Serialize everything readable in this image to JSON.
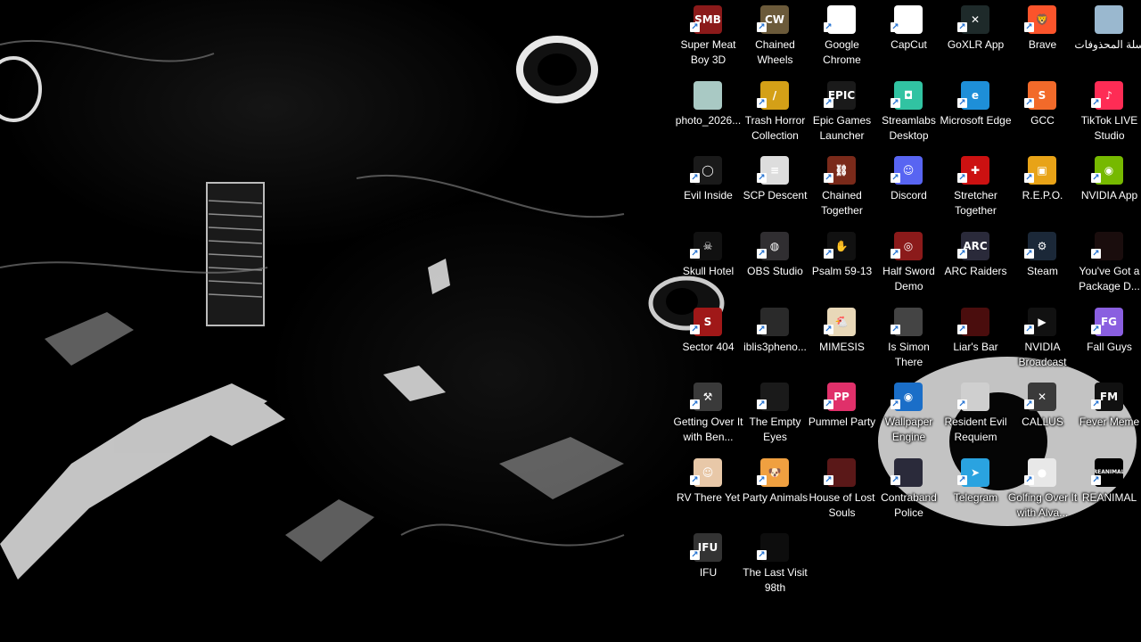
{
  "desktop": {
    "icons": [
      {
        "label": "Super Meat Boy 3D",
        "icon": "super-meat-boy-3d-icon",
        "color": "#8b1a1a",
        "glyph": "SMB",
        "shortcut": true
      },
      {
        "label": "Chained Wheels",
        "icon": "chained-wheels-icon",
        "color": "#6b5a3a",
        "glyph": "CW",
        "shortcut": true
      },
      {
        "label": "Google Chrome",
        "icon": "chrome-icon",
        "color": "#ffffff",
        "glyph": "",
        "shortcut": true
      },
      {
        "label": "CapCut",
        "icon": "capcut-icon",
        "color": "#ffffff",
        "glyph": "✂",
        "shortcut": true
      },
      {
        "label": "GoXLR App",
        "icon": "goxlr-icon",
        "color": "#1e2a2a",
        "glyph": "✕",
        "shortcut": true
      },
      {
        "label": "Brave",
        "icon": "brave-icon",
        "color": "#fb542b",
        "glyph": "🦁",
        "shortcut": true
      },
      {
        "label": "سلة المحذوفات",
        "icon": "recycle-bin-icon",
        "color": "#9ab8cf",
        "glyph": "",
        "shortcut": false
      },
      {
        "label": "photo_2026...",
        "icon": "photo-file-icon",
        "color": "#a9c9c4",
        "glyph": "",
        "shortcut": false
      },
      {
        "label": "Trash Horror Collection",
        "icon": "trash-horror-collection-icon",
        "color": "#d4a017",
        "glyph": "/",
        "shortcut": true
      },
      {
        "label": "Epic Games Launcher",
        "icon": "epic-games-icon",
        "color": "#1a1a1a",
        "glyph": "EPIC",
        "shortcut": true
      },
      {
        "label": "Streamlabs Desktop",
        "icon": "streamlabs-icon",
        "color": "#31c3a2",
        "glyph": "◘",
        "shortcut": true
      },
      {
        "label": "Microsoft Edge",
        "icon": "edge-icon",
        "color": "#1e8fd8",
        "glyph": "e",
        "shortcut": true
      },
      {
        "label": "GCC",
        "icon": "gcc-icon",
        "color": "#f26a2a",
        "glyph": "S",
        "shortcut": true
      },
      {
        "label": "TikTok LIVE Studio",
        "icon": "tiktok-live-studio-icon",
        "color": "#fe2c55",
        "glyph": "♪",
        "shortcut": true
      },
      {
        "label": "Evil Inside",
        "icon": "evil-inside-icon",
        "color": "#1a1a1a",
        "glyph": "◯",
        "shortcut": true
      },
      {
        "label": "SCP Descent",
        "icon": "scp-descent-icon",
        "color": "#dddddd",
        "glyph": "≡",
        "shortcut": true
      },
      {
        "label": "Chained Together",
        "icon": "chained-together-icon",
        "color": "#7a2a1a",
        "glyph": "⛓",
        "shortcut": true
      },
      {
        "label": "Discord",
        "icon": "discord-icon",
        "color": "#5865f2",
        "glyph": "☺",
        "shortcut": true
      },
      {
        "label": "Stretcher Together",
        "icon": "stretcher-together-icon",
        "color": "#cc1111",
        "glyph": "✚",
        "shortcut": true
      },
      {
        "label": "R.E.P.O.",
        "icon": "repo-icon",
        "color": "#e8a317",
        "glyph": "▣",
        "shortcut": true
      },
      {
        "label": "NVIDIA App",
        "icon": "nvidia-app-icon",
        "color": "#76b900",
        "glyph": "◉",
        "shortcut": true
      },
      {
        "label": "Skull Hotel",
        "icon": "skull-hotel-icon",
        "color": "#111111",
        "glyph": "☠",
        "shortcut": true
      },
      {
        "label": "OBS Studio",
        "icon": "obs-studio-icon",
        "color": "#302e31",
        "glyph": "◍",
        "shortcut": true
      },
      {
        "label": "Psalm 59-13",
        "icon": "psalm-59-13-icon",
        "color": "#111111",
        "glyph": "✋",
        "shortcut": true
      },
      {
        "label": "Half Sword Demo",
        "icon": "half-sword-demo-icon",
        "color": "#8b1a1a",
        "glyph": "◎",
        "shortcut": true
      },
      {
        "label": "ARC Raiders",
        "icon": "arc-raiders-icon",
        "color": "#2a2a3a",
        "glyph": "ARC",
        "shortcut": true
      },
      {
        "label": "Steam",
        "icon": "steam-icon",
        "color": "#1b2838",
        "glyph": "⚙",
        "shortcut": true
      },
      {
        "label": "You've Got a Package D...",
        "icon": "youve-got-a-package-icon",
        "color": "#1a0d0d",
        "glyph": "",
        "shortcut": true
      },
      {
        "label": "Sector 404",
        "icon": "sector-404-icon",
        "color": "#a01818",
        "glyph": "S",
        "shortcut": true
      },
      {
        "label": "iblis3pheno...",
        "icon": "iblis3pheno-icon",
        "color": "#2a2a2a",
        "glyph": "",
        "shortcut": true
      },
      {
        "label": "MIMESIS",
        "icon": "mimesis-icon",
        "color": "#e8d8b8",
        "glyph": "🐔",
        "shortcut": true
      },
      {
        "label": "Is Simon There",
        "icon": "is-simon-there-icon",
        "color": "#444444",
        "glyph": "",
        "shortcut": true
      },
      {
        "label": "Liar's Bar",
        "icon": "liars-bar-icon",
        "color": "#4a0d0d",
        "glyph": "",
        "shortcut": true
      },
      {
        "label": "NVIDIA Broadcast",
        "icon": "nvidia-broadcast-icon",
        "color": "#111111",
        "glyph": "▶",
        "shortcut": true
      },
      {
        "label": "Fall Guys",
        "icon": "fall-guys-icon",
        "color": "#8a5fe0",
        "glyph": "FG",
        "shortcut": true
      },
      {
        "label": "Getting Over It with Ben...",
        "icon": "getting-over-it-icon",
        "color": "#3a3a3a",
        "glyph": "⚒",
        "shortcut": true
      },
      {
        "label": "The Empty Eyes",
        "icon": "the-empty-eyes-icon",
        "color": "#1a1a1a",
        "glyph": "",
        "shortcut": true
      },
      {
        "label": "Pummel Party",
        "icon": "pummel-party-icon",
        "color": "#e0306a",
        "glyph": "PP",
        "shortcut": true
      },
      {
        "label": "Wallpaper Engine",
        "icon": "wallpaper-engine-icon",
        "color": "#1a6ec8",
        "glyph": "◉",
        "shortcut": true
      },
      {
        "label": "Resident Evil Requiem",
        "icon": "resident-evil-requiem-icon",
        "color": "#cfcfcf",
        "glyph": "",
        "shortcut": true
      },
      {
        "label": "CALLUS",
        "icon": "callus-icon",
        "color": "#3a3a3a",
        "glyph": "✕",
        "shortcut": true
      },
      {
        "label": "Fever Meme",
        "icon": "fever-meme-icon",
        "color": "#111111",
        "glyph": "FM",
        "shortcut": true
      },
      {
        "label": "RV There Yet",
        "icon": "rv-there-yet-icon",
        "color": "#e8c8a8",
        "glyph": "☺",
        "shortcut": true
      },
      {
        "label": "Party Animals",
        "icon": "party-animals-icon",
        "color": "#f0a040",
        "glyph": "🐶",
        "shortcut": true
      },
      {
        "label": "House of Lost Souls",
        "icon": "house-of-lost-souls-icon",
        "color": "#5a1818",
        "glyph": "",
        "shortcut": true
      },
      {
        "label": "Contraband Police",
        "icon": "contraband-police-icon",
        "color": "#2a2a3a",
        "glyph": "",
        "shortcut": true
      },
      {
        "label": "Telegram",
        "icon": "telegram-icon",
        "color": "#2aa3e0",
        "glyph": "➤",
        "shortcut": true
      },
      {
        "label": "Golfing Over It with Alva...",
        "icon": "golfing-over-it-icon",
        "color": "#e8e8e8",
        "glyph": "●",
        "shortcut": true
      },
      {
        "label": "REANIMAL",
        "icon": "reanimal-icon",
        "color": "#000000",
        "glyph": "REANIMAL",
        "shortcut": true
      },
      {
        "label": "IFU",
        "icon": "ifu-icon",
        "color": "#333333",
        "glyph": "IFU",
        "shortcut": true
      },
      {
        "label": "The Last Visit 98th",
        "icon": "the-last-visit-98th-icon",
        "color": "#0d0d0d",
        "glyph": "",
        "shortcut": true
      }
    ]
  }
}
